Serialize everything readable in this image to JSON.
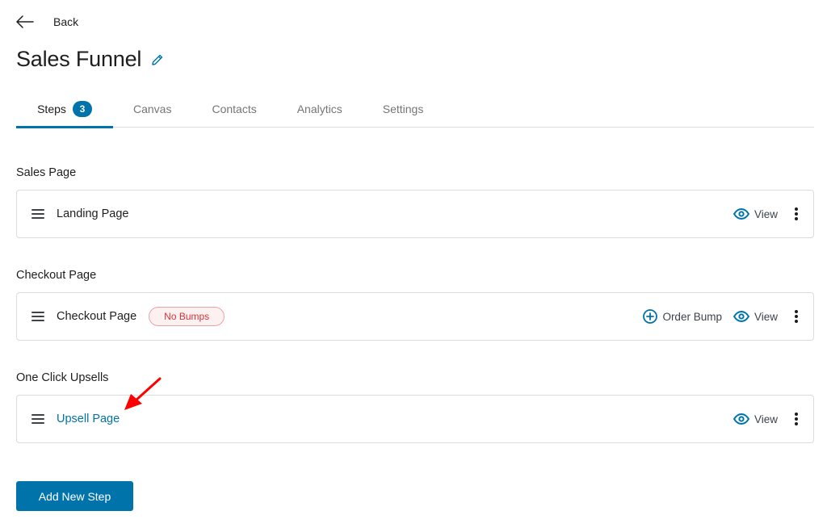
{
  "header": {
    "back_label": "Back",
    "title": "Sales Funnel"
  },
  "tabs": [
    {
      "label": "Steps",
      "badge": "3",
      "active": true
    },
    {
      "label": "Canvas"
    },
    {
      "label": "Contacts"
    },
    {
      "label": "Analytics"
    },
    {
      "label": "Settings"
    }
  ],
  "sections": [
    {
      "title": "Sales Page",
      "steps": [
        {
          "name": "Landing Page",
          "actions": [
            {
              "icon": "eye-icon",
              "label": "View"
            }
          ]
        }
      ]
    },
    {
      "title": "Checkout Page",
      "steps": [
        {
          "name": "Checkout Page",
          "badge": "No Bumps",
          "actions": [
            {
              "icon": "plus-circle-icon",
              "label": "Order Bump"
            },
            {
              "icon": "eye-icon",
              "label": "View"
            }
          ]
        }
      ]
    },
    {
      "title": "One Click Upsells",
      "steps": [
        {
          "name": "Upsell Page",
          "highlighted": true,
          "actions": [
            {
              "icon": "eye-icon",
              "label": "View"
            }
          ]
        }
      ]
    }
  ],
  "footer": {
    "add_step_label": "Add New Step"
  },
  "colors": {
    "accent": "#0073aa",
    "danger": "#d63638",
    "annotation_arrow": "#ff0000"
  }
}
